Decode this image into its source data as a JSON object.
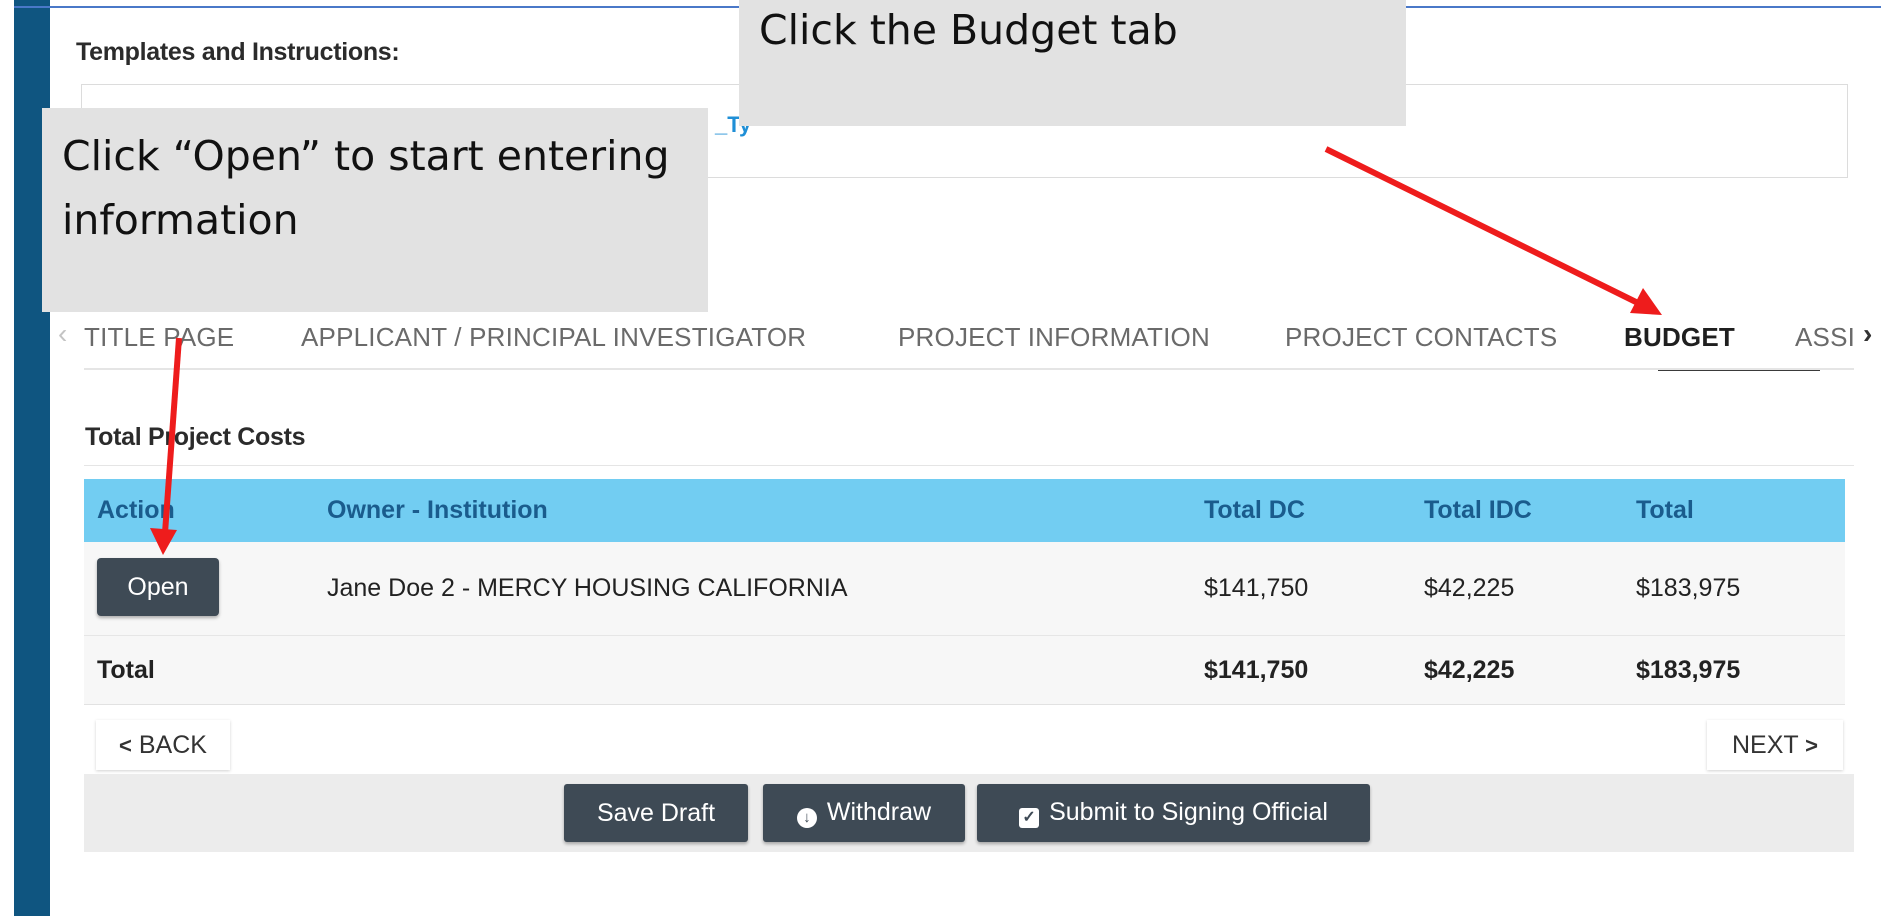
{
  "templates": {
    "label": "Templates and Instructions:",
    "link_fragment": "_Ty"
  },
  "tabs": [
    {
      "label": "TITLE PAGE",
      "active": false
    },
    {
      "label": "APPLICANT / PRINCIPAL INVESTIGATOR",
      "active": false
    },
    {
      "label": "PROJECT INFORMATION",
      "active": false
    },
    {
      "label": "PROJECT CONTACTS",
      "active": false
    },
    {
      "label": "BUDGET",
      "active": true
    },
    {
      "label": "ASSI",
      "active": false
    }
  ],
  "section_title": "Total Project Costs",
  "table": {
    "headers": [
      "Action",
      "Owner - Institution",
      "Total DC",
      "Total IDC",
      "Total"
    ],
    "rows": [
      {
        "action_label": "Open",
        "owner": "Jane Doe 2 - MERCY HOUSING CALIFORNIA",
        "total_dc": "$141,750",
        "total_idc": "$42,225",
        "total": "$183,975"
      }
    ],
    "total_row": {
      "label": "Total",
      "total_dc": "$141,750",
      "total_idc": "$42,225",
      "total": "$183,975"
    }
  },
  "nav": {
    "back_label": "BACK",
    "next_label": "NEXT"
  },
  "actions": {
    "save_label": "Save Draft",
    "withdraw_label": "Withdraw",
    "submit_label": "Submit to Signing Official"
  },
  "callouts": {
    "open_text": "Click “Open” to start entering information",
    "budget_text": "Click the Budget tab"
  },
  "colors": {
    "sidebar": "#0f5580",
    "table_header": "#72cdf2",
    "button_dark": "#3e4a55",
    "annotation_arrow": "#ee1c1c"
  },
  "icons": [
    "chevron-left-icon",
    "chevron-right-icon",
    "arrow-circle-down-icon",
    "checkbox-icon"
  ]
}
